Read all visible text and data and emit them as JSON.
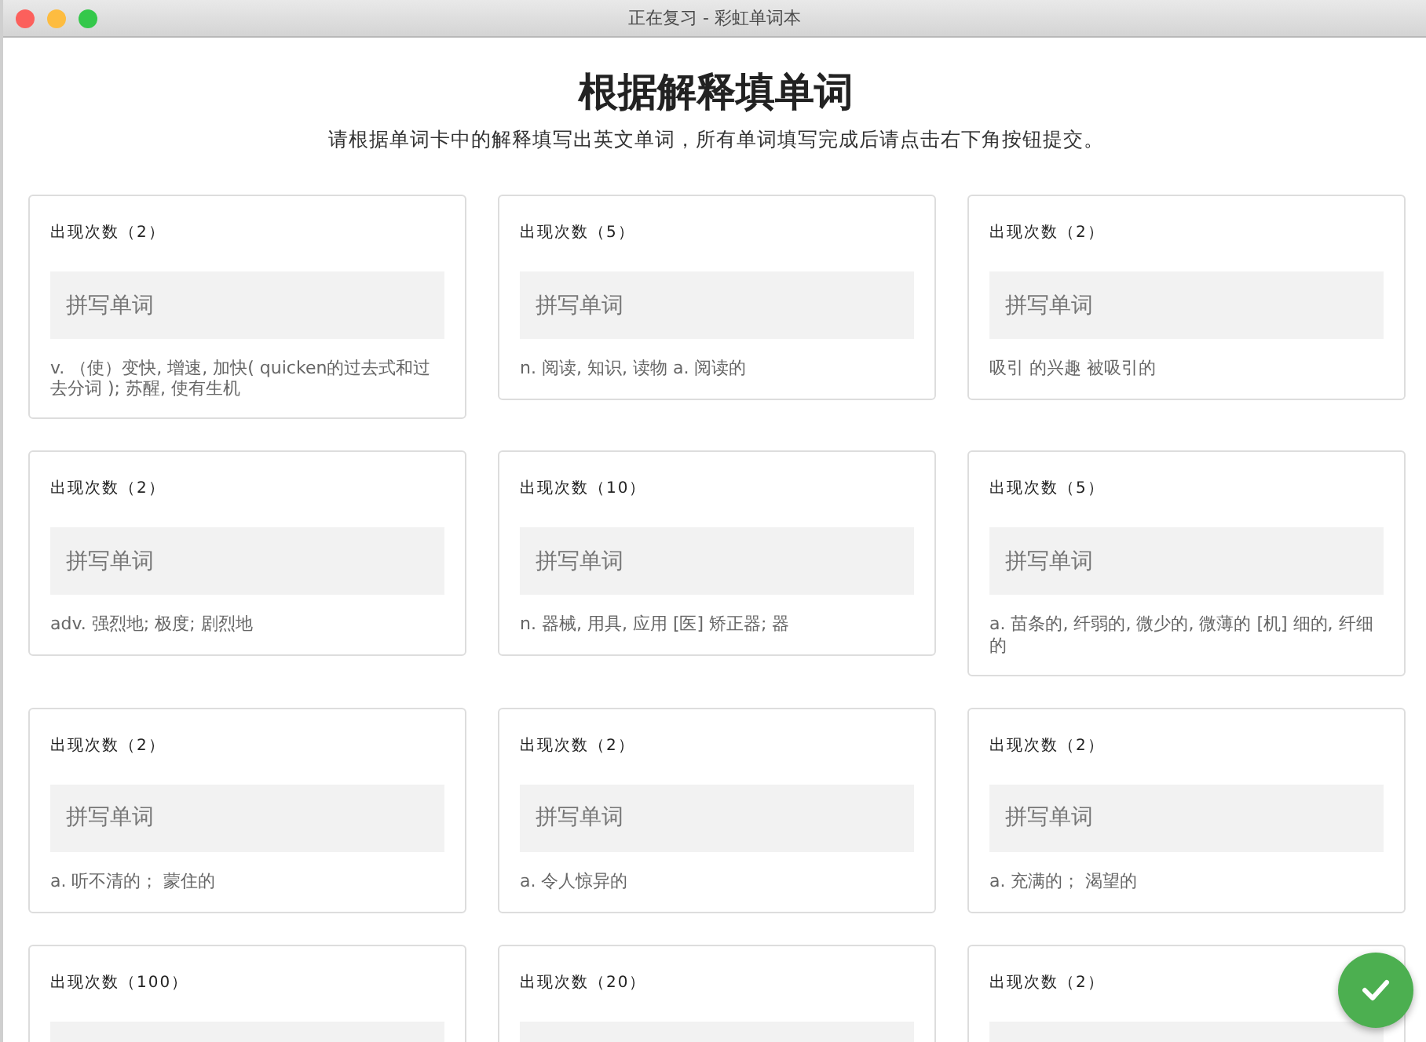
{
  "window": {
    "title": "正在复习 - 彩虹单词本"
  },
  "heading": "根据解释填单词",
  "instructions": "请根据单词卡中的解释填写出英文单词，所有单词填写完成后请点击右下角按钮提交。",
  "cards": [
    {
      "count": "出现次数（2）",
      "placeholder": "拼写单词",
      "definition": "v. （使）变快, 增速, 加快( quicken的过去式和过去分词 ); 苏醒, 使有生机"
    },
    {
      "count": "出现次数（5）",
      "placeholder": "拼写单词",
      "definition": "n. 阅读, 知识, 读物 a. 阅读的"
    },
    {
      "count": "出现次数（2）",
      "placeholder": "拼写单词",
      "definition": "吸引 的兴趣 被吸引的"
    },
    {
      "count": "出现次数（2）",
      "placeholder": "拼写单词",
      "definition": "adv. 强烈地; 极度; 剧烈地"
    },
    {
      "count": "出现次数（10）",
      "placeholder": "拼写单词",
      "definition": "n. 器械, 用具, 应用 [医] 矫正器; 器"
    },
    {
      "count": "出现次数（5）",
      "placeholder": "拼写单词",
      "definition": "a. 苗条的, 纤弱的, 微少的, 微薄的 [机] 细的, 纤细的"
    },
    {
      "count": "出现次数（2）",
      "placeholder": "拼写单词",
      "definition": "a. 听不清的； 蒙住的"
    },
    {
      "count": "出现次数（2）",
      "placeholder": "拼写单词",
      "definition": "a. 令人惊异的"
    },
    {
      "count": "出现次数（2）",
      "placeholder": "拼写单词",
      "definition": "a. 充满的； 渴望的"
    },
    {
      "count": "出现次数（100）"
    },
    {
      "count": "出现次数（20）"
    },
    {
      "count": "出现次数（2）"
    }
  ]
}
